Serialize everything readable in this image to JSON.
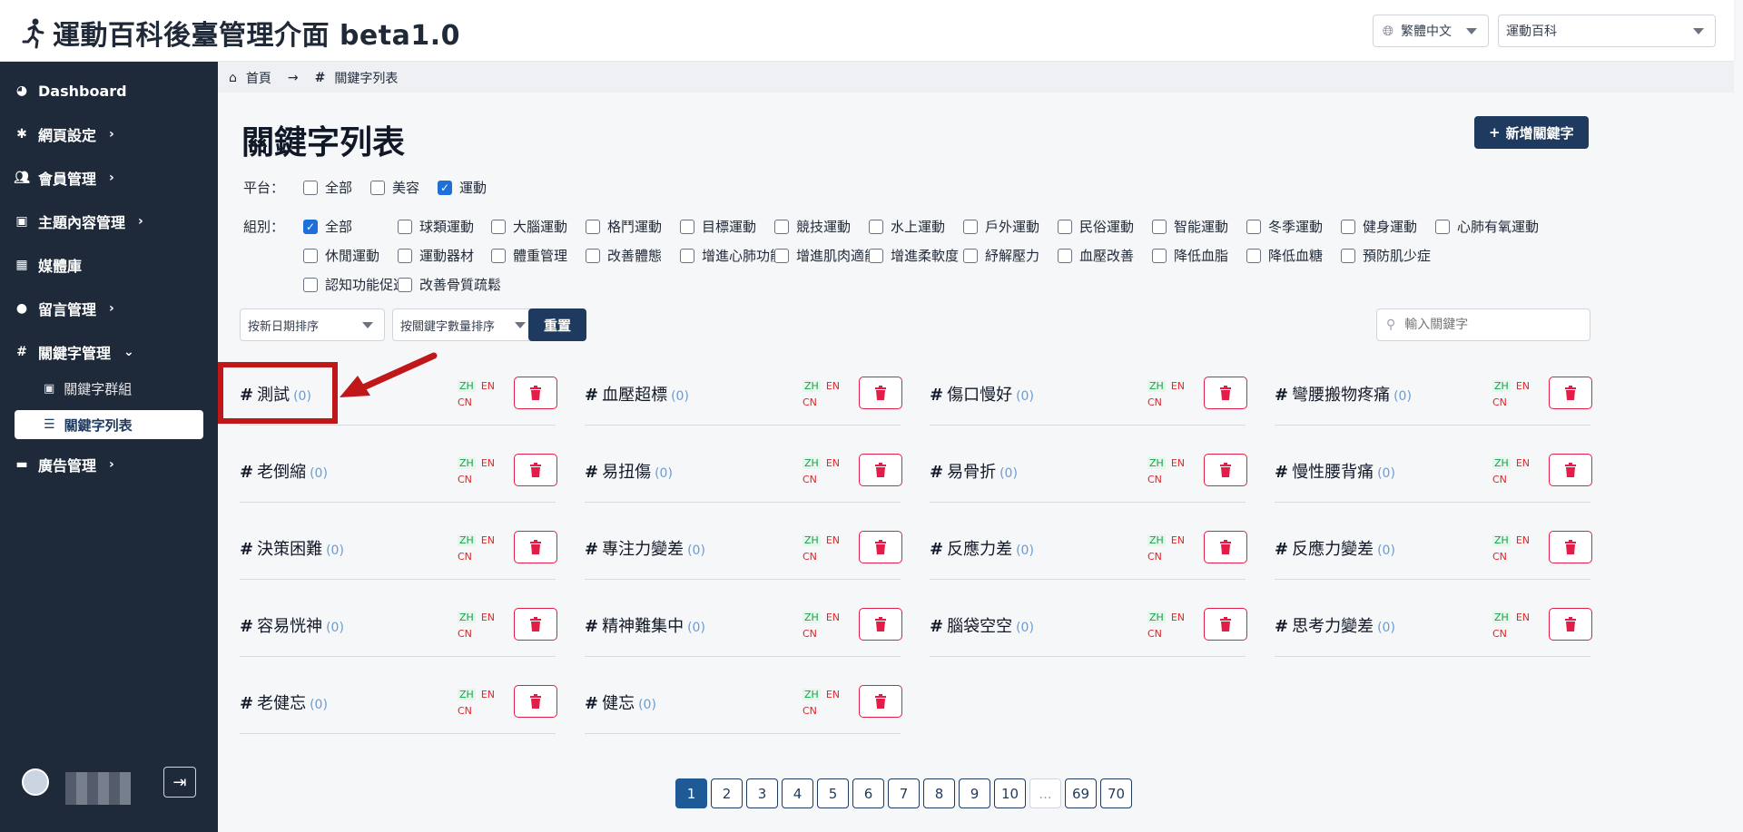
{
  "header": {
    "title": "運動百科後臺管理介面 beta1.0",
    "language": "繁體中文",
    "site": "運動百科"
  },
  "sidebar": {
    "items": [
      {
        "label": "Dashboard",
        "icon": "dashboard-icon"
      },
      {
        "label": "網頁設定",
        "icon": "gear-icon"
      },
      {
        "label": "會員管理",
        "icon": "users-icon"
      },
      {
        "label": "主題內容管理",
        "icon": "content-icon"
      },
      {
        "label": "媒體庫",
        "icon": "images-icon"
      },
      {
        "label": "留言管理",
        "icon": "comment-icon"
      },
      {
        "label": "關鍵字管理",
        "icon": "hash-icon"
      },
      {
        "label": "廣告管理",
        "icon": "ad-icon"
      }
    ],
    "subitems": [
      {
        "label": "關鍵字群組"
      },
      {
        "label": "關鍵字列表"
      }
    ]
  },
  "breadcrumb": {
    "home": "首頁",
    "current": "關鍵字列表"
  },
  "main": {
    "title": "關鍵字列表",
    "add_button": "新增關鍵字",
    "platform_label": "平台：",
    "group_label": "組別：",
    "platforms": [
      {
        "label": "全部",
        "checked": false
      },
      {
        "label": "美容",
        "checked": false
      },
      {
        "label": "運動",
        "checked": true
      }
    ],
    "groups": [
      {
        "label": "全部",
        "checked": true
      },
      {
        "label": "球類運動",
        "checked": false
      },
      {
        "label": "大腦運動",
        "checked": false
      },
      {
        "label": "格鬥運動",
        "checked": false
      },
      {
        "label": "目標運動",
        "checked": false
      },
      {
        "label": "競技運動",
        "checked": false
      },
      {
        "label": "水上運動",
        "checked": false
      },
      {
        "label": "戶外運動",
        "checked": false
      },
      {
        "label": "民俗運動",
        "checked": false
      },
      {
        "label": "智能運動",
        "checked": false
      },
      {
        "label": "冬季運動",
        "checked": false
      },
      {
        "label": "健身運動",
        "checked": false
      },
      {
        "label": "心肺有氧運動",
        "checked": false
      },
      {
        "label": "休閒運動",
        "checked": false
      },
      {
        "label": "運動器材",
        "checked": false
      },
      {
        "label": "體重管理",
        "checked": false
      },
      {
        "label": "改善體態",
        "checked": false
      },
      {
        "label": "增進心肺功能",
        "checked": false
      },
      {
        "label": "增進肌肉適能",
        "checked": false
      },
      {
        "label": "增進柔軟度",
        "checked": false
      },
      {
        "label": "紓解壓力",
        "checked": false
      },
      {
        "label": "血壓改善",
        "checked": false
      },
      {
        "label": "降低血脂",
        "checked": false
      },
      {
        "label": "降低血糖",
        "checked": false
      },
      {
        "label": "預防肌少症",
        "checked": false
      },
      {
        "label": "認知功能促進",
        "checked": false
      },
      {
        "label": "改善骨質疏鬆",
        "checked": false
      }
    ],
    "sort_date": "按新日期排序",
    "sort_count": "按關鍵字數量排序",
    "reset_button": "重置",
    "search_placeholder": "輸入關鍵字"
  },
  "keywords": [
    {
      "name": "測試",
      "count": "(0)"
    },
    {
      "name": "血壓超標",
      "count": "(0)"
    },
    {
      "name": "傷口慢好",
      "count": "(0)"
    },
    {
      "name": "彎腰搬物疼痛",
      "count": "(0)"
    },
    {
      "name": "老倒縮",
      "count": "(0)"
    },
    {
      "name": "易扭傷",
      "count": "(0)"
    },
    {
      "name": "易骨折",
      "count": "(0)"
    },
    {
      "name": "慢性腰背痛",
      "count": "(0)"
    },
    {
      "name": "決策困難",
      "count": "(0)"
    },
    {
      "name": "專注力變差",
      "count": "(0)"
    },
    {
      "name": "反應力差",
      "count": "(0)"
    },
    {
      "name": "反應力變差",
      "count": "(0)"
    },
    {
      "name": "容易恍神",
      "count": "(0)"
    },
    {
      "name": "精神難集中",
      "count": "(0)"
    },
    {
      "name": "腦袋空空",
      "count": "(0)"
    },
    {
      "name": "思考力變差",
      "count": "(0)"
    },
    {
      "name": "老健忘",
      "count": "(0)"
    },
    {
      "name": "健忘",
      "count": "(0)"
    }
  ],
  "lang_tags": {
    "zh": "ZH",
    "en": "EN",
    "cn": "CN"
  },
  "pagination": [
    "1",
    "2",
    "3",
    "4",
    "5",
    "6",
    "7",
    "8",
    "9",
    "10",
    "...",
    "69",
    "70"
  ],
  "pagination_active": "1",
  "colors": {
    "sidebar_bg": "#1e2a3a",
    "primary": "#1e3a5f",
    "danger": "#e11d48",
    "highlight": "#c01818"
  }
}
